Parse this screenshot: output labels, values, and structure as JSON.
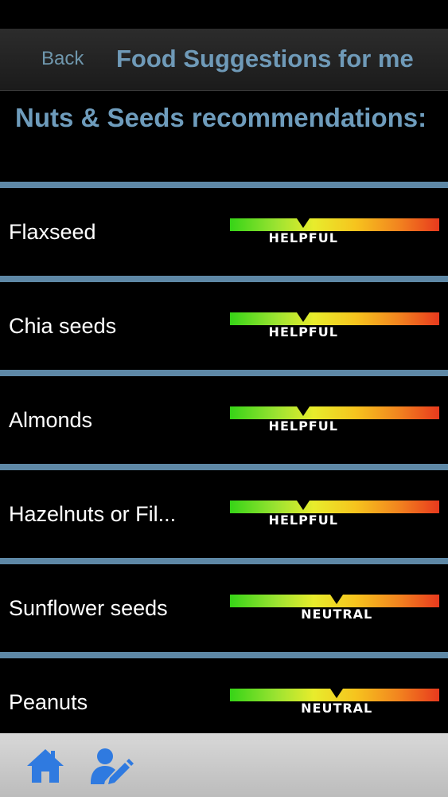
{
  "nav": {
    "back_label": "Back",
    "title": "Food Suggestions for me"
  },
  "section": {
    "heading": "Nuts & Seeds recommendations:"
  },
  "items": [
    {
      "name": "Flaxseed",
      "rating": "HELPFUL",
      "level": 0.35
    },
    {
      "name": "Chia seeds",
      "rating": "HELPFUL",
      "level": 0.35
    },
    {
      "name": "Almonds",
      "rating": "HELPFUL",
      "level": 0.35
    },
    {
      "name": "Hazelnuts or Fil...",
      "rating": "HELPFUL",
      "level": 0.35
    },
    {
      "name": "Sunflower seeds",
      "rating": "NEUTRAL",
      "level": 0.51
    },
    {
      "name": "Peanuts",
      "rating": "NEUTRAL",
      "level": 0.51
    }
  ],
  "tabs": [
    {
      "icon": "home-icon"
    },
    {
      "icon": "edit-profile-icon"
    }
  ],
  "colors": {
    "accent": "#6f9ab8",
    "divider": "#5e88a6",
    "tab_icon": "#2f7ae0"
  }
}
